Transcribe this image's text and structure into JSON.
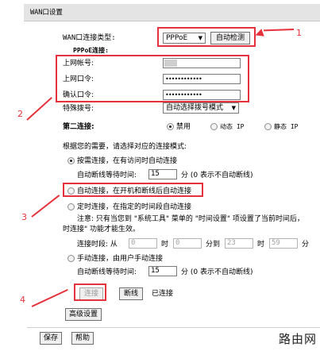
{
  "title": "WAN口设置",
  "conn_type": {
    "label": "WAN口连接类型:",
    "value": "PPPoE",
    "detect_btn": "自动检测"
  },
  "pppoe": {
    "section": "PPPoE连接:",
    "account_label": "上网帐号:",
    "password_label": "上网口令:",
    "password_value": "••••••••••••",
    "confirm_label": "确认口令:",
    "confirm_value": "••••••••••••"
  },
  "dial": {
    "label": "特殊拨号:",
    "value": "自动选择拨号模式"
  },
  "second_conn": {
    "label": "第二连接:",
    "opt_disable": "禁用",
    "opt_dynamic": "动态 IP",
    "opt_static": "静态 IP"
  },
  "mode_intro": "根据您的需要，请选择对应的连接模式:",
  "mode_demand": {
    "label": "按需连接，在有访问时自动连接",
    "idle_label": "自动断线等待时间:",
    "idle_value": "15",
    "idle_unit": "分 (0 表示不自动断线)"
  },
  "mode_auto": {
    "label": "自动连接，在开机和断线后自动连接"
  },
  "mode_timed": {
    "label": "定时连接，在指定的时间段自动连接",
    "note_line1": "注意: 只有当您到 \"系统工具\" 菜单的 \"时间设置\" 项设置了当前时间后，",
    "note_line2": "时连接\" 功能才能生效。",
    "period_label": "连接时段: 从",
    "from_h": "0",
    "h_unit": "时",
    "from_m": "0",
    "to_label": "分到",
    "to_h": "23",
    "to_m": "59",
    "m_unit": "分"
  },
  "mode_manual": {
    "label": "手动连接，由用户手动连接",
    "idle_label": "自动断线等待时间:",
    "idle_value": "15",
    "idle_unit": "分 (0 表示不自动断线)"
  },
  "actions": {
    "connect": "连接",
    "disconnect": "断线",
    "status": "已连接",
    "advanced": "高级设置",
    "save": "保存",
    "help": "帮助"
  },
  "annotations": {
    "n1": "1",
    "n2": "2",
    "n3": "3",
    "n4": "4",
    "color": "#e6323c"
  },
  "watermark": "路由网"
}
